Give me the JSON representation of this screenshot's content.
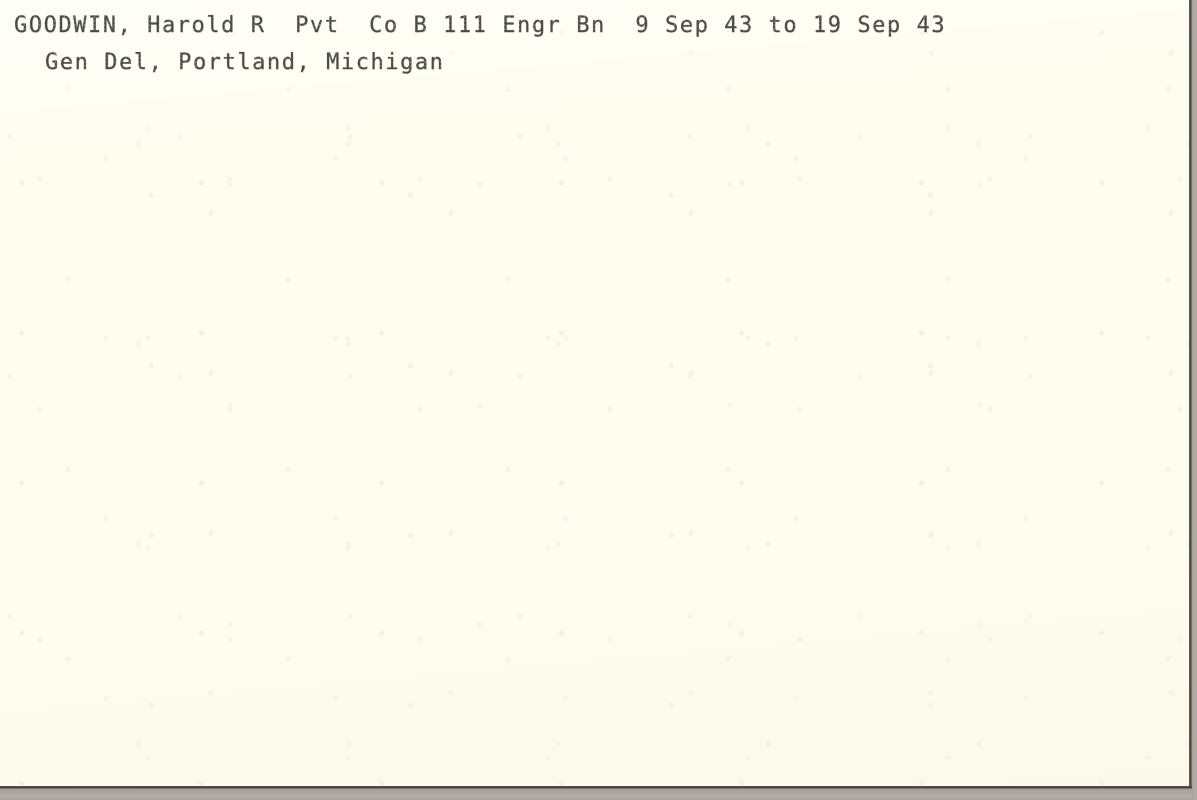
{
  "document": {
    "type": "index-card",
    "medium": "typewritten",
    "colors": {
      "paper": "#fdfdf0",
      "ink": "#4c4a46",
      "card_edge": "#3e3935",
      "scanner_bed": "#b2aba5"
    },
    "lines": [
      {
        "id": "line-1",
        "text": "GOODWIN, Harold R  Pvt  Co B 111 Engr Bn  9 Sep 43 to 19 Sep 43",
        "fields": {
          "surname": "GOODWIN",
          "given_names": "Harold R",
          "rank": "Pvt",
          "unit": "Co B 111 Engr Bn",
          "date_from": "9 Sep 43",
          "date_to": "19 Sep 43",
          "date_separator": "to"
        }
      },
      {
        "id": "line-2",
        "text": "Gen Del, Portland, Michigan",
        "fields": {
          "address": "Gen Del",
          "city": "Portland",
          "state": "Michigan"
        }
      }
    ]
  }
}
